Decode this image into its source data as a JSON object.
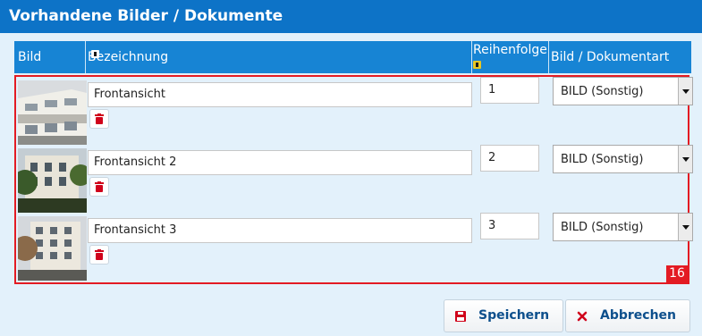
{
  "panel": {
    "title": "Vorhandene Bilder / Dokumente"
  },
  "table": {
    "columns": {
      "bild": "Bild",
      "bezeichnung": "Bezeichnung",
      "reihenfolge": "Reihenfolge",
      "bildart": "Bild / Dokumentart"
    },
    "rows": [
      {
        "bezeichnung": "Frontansicht",
        "reihenfolge": "1",
        "art": "BILD (Sonstig)"
      },
      {
        "bezeichnung": "Frontansicht 2",
        "reihenfolge": "2",
        "art": "BILD (Sonstig)"
      },
      {
        "bezeichnung": "Frontansicht 3",
        "reihenfolge": "3",
        "art": "BILD (Sonstig)"
      }
    ]
  },
  "annotation": {
    "count": "16",
    "color": "#e31b23"
  },
  "buttons": {
    "save": "Speichern",
    "cancel": "Abbrechen"
  },
  "colors": {
    "header": "#0d73c7",
    "table_header": "#1784d4",
    "background": "#e3f1fb",
    "delete": "#d0021b"
  }
}
